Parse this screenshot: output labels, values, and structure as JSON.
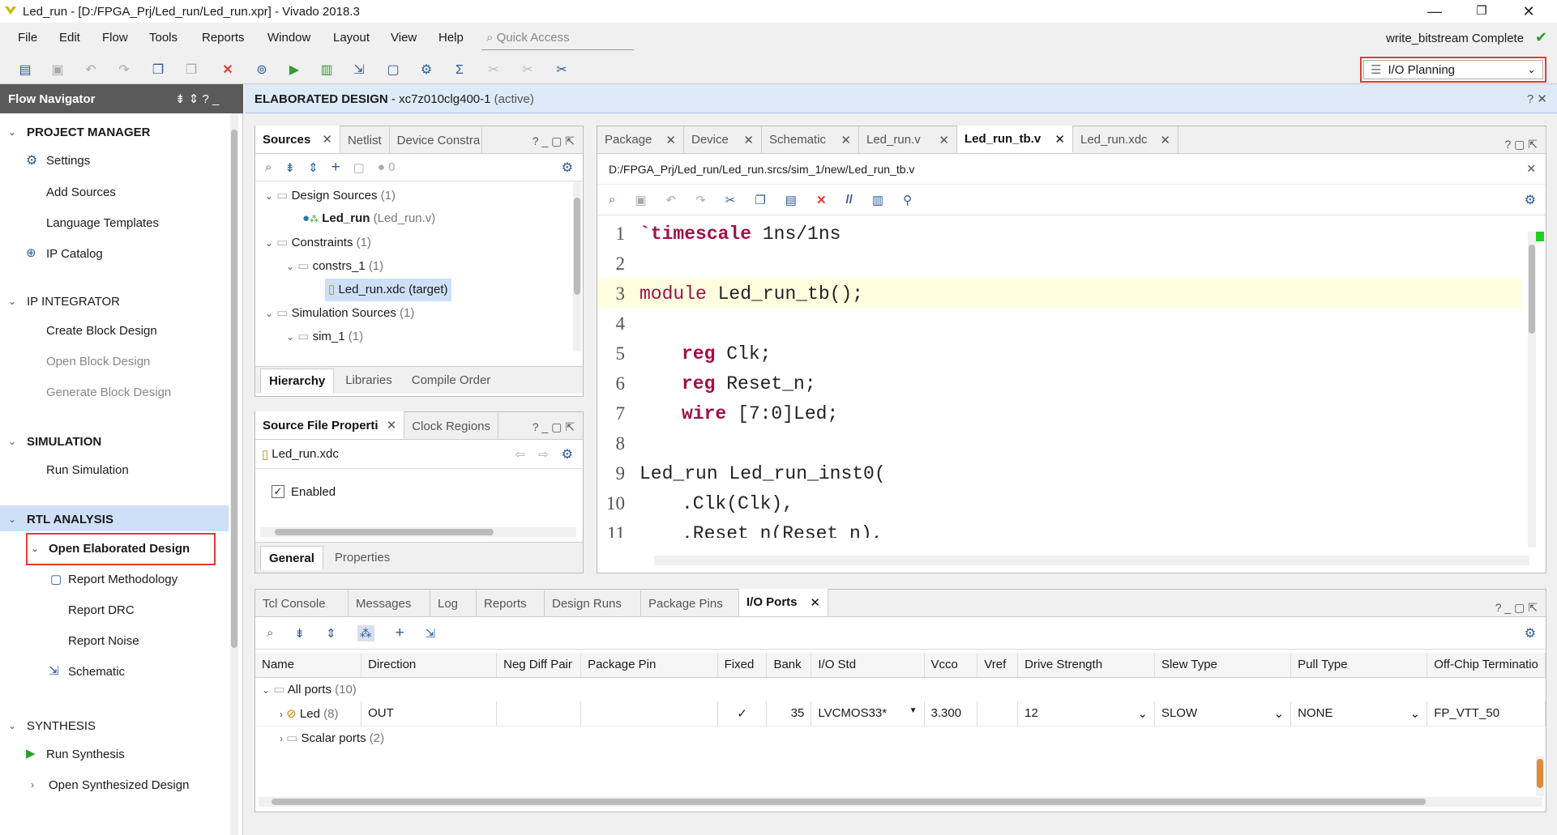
{
  "window": {
    "title": "Led_run - [D:/FPGA_Prj/Led_run/Led_run.xpr] - Vivado 2018.3"
  },
  "menu": [
    "File",
    "Edit",
    "Flow",
    "Tools",
    "Reports",
    "Window",
    "Layout",
    "View",
    "Help"
  ],
  "quick_access": "Quick Access",
  "status": "write_bitstream Complete",
  "layout_select": "I/O Planning",
  "flow_nav": {
    "title": "Flow Navigator",
    "sections": {
      "project_manager": "PROJECT MANAGER",
      "ip_integrator": "IP INTEGRATOR",
      "simulation": "SIMULATION",
      "rtl_analysis": "RTL ANALYSIS",
      "synthesis": "SYNTHESIS"
    },
    "items": {
      "settings": "Settings",
      "add_sources": "Add Sources",
      "language_templates": "Language Templates",
      "ip_catalog": "IP Catalog",
      "create_block": "Create Block Design",
      "open_block": "Open Block Design",
      "generate_block": "Generate Block Design",
      "run_sim": "Run Simulation",
      "open_elab": "Open Elaborated Design",
      "report_meth": "Report Methodology",
      "report_drc": "Report DRC",
      "report_noise": "Report Noise",
      "schematic": "Schematic",
      "run_synth": "Run Synthesis",
      "open_synth": "Open Synthesized Design"
    }
  },
  "elab": {
    "title": "ELABORATED DESIGN",
    "part": " - xc7z010clg400-1",
    "state": "(active)"
  },
  "sources": {
    "tabs": [
      "Sources",
      "Netlist",
      "Device Constra"
    ],
    "count": "0",
    "tree": {
      "design": "Design Sources",
      "design_n": "(1)",
      "ledrun": "Led_run",
      "ledrun_file": "(Led_run.v)",
      "constraints": "Constraints",
      "constraints_n": "(1)",
      "constrs": "constrs_1",
      "constrs_n": "(1)",
      "xdc": "Led_run.xdc (target)",
      "sim": "Simulation Sources",
      "sim_n": "(1)",
      "sim1": "sim_1",
      "sim1_n": "(1)"
    },
    "subtabs": [
      "Hierarchy",
      "Libraries",
      "Compile Order"
    ]
  },
  "props": {
    "tabs": [
      "Source File Properti",
      "Clock Regions"
    ],
    "file": "Led_run.xdc",
    "enabled": "Enabled",
    "subtabs": [
      "General",
      "Properties"
    ]
  },
  "editor": {
    "tabs": [
      "Package",
      "Device",
      "Schematic",
      "Led_run.v",
      "Led_run_tb.v",
      "Led_run.xdc"
    ],
    "path": "D:/FPGA_Prj/Led_run/Led_run.srcs/sim_1/new/Led_run_tb.v",
    "lines": [
      {
        "n": "1",
        "kw": "`timescale",
        "rest": " 1ns/1ns"
      },
      {
        "n": "2",
        "kw": "",
        "rest": ""
      },
      {
        "n": "3",
        "kw": "module",
        "rest": " Led_run_tb();"
      },
      {
        "n": "4",
        "kw": "",
        "rest": ""
      },
      {
        "n": "5",
        "kw": "reg",
        "rest": " Clk;"
      },
      {
        "n": "6",
        "kw": "reg",
        "rest": " Reset_n;"
      },
      {
        "n": "7",
        "kw": "wire",
        "rest": " [7:0]Led;"
      },
      {
        "n": "8",
        "kw": "",
        "rest": ""
      },
      {
        "n": "9",
        "kw": "",
        "rest": "Led_run Led_run_inst0("
      },
      {
        "n": "10",
        "kw": "",
        "rest": ".Clk(Clk),"
      },
      {
        "n": "11",
        "kw": "",
        "rest": ".Reset_n(Reset_n),"
      }
    ]
  },
  "bottom": {
    "tabs": [
      "Tcl Console",
      "Messages",
      "Log",
      "Reports",
      "Design Runs",
      "Package Pins",
      "I/O Ports"
    ],
    "columns": [
      "Name",
      "Direction",
      "Neg Diff Pair",
      "Package Pin",
      "Fixed",
      "Bank",
      "I/O Std",
      "Vcco",
      "Vref",
      "Drive Strength",
      "Slew Type",
      "Pull Type",
      "Off-Chip Terminatio"
    ],
    "all_ports": "All ports",
    "all_ports_n": "(10)",
    "led": {
      "name": "Led",
      "n": "(8)",
      "dir": "OUT",
      "fixed": "✓",
      "bank": "35",
      "iostd": "LVCMOS33*",
      "vcco": "3.300",
      "drive": "12",
      "slew": "SLOW",
      "pull": "NONE",
      "term": "FP_VTT_50"
    },
    "scalar": "Scalar ports",
    "scalar_n": "(2)"
  }
}
